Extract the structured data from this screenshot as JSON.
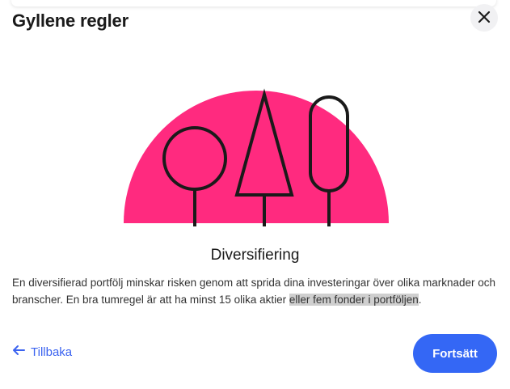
{
  "modal": {
    "title": "Gyllene regler",
    "close_icon": "close-icon"
  },
  "illustration": {
    "description_icon": "trees-illustration",
    "colors": {
      "sun": "#ff2a7f",
      "stroke": "#1a1a1a"
    }
  },
  "content": {
    "heading": "Diversifiering",
    "text_main": "En diversifierad portfölj minskar risken genom att sprida dina investeringar över olika marknader och branscher. En bra tumregel är att ha minst 15 olika aktier ",
    "text_highlighted": "eller fem fonder i portföljen",
    "text_end": "."
  },
  "footer": {
    "back_label": "Tillbaka",
    "back_icon": "arrow-left-icon",
    "continue_label": "Fortsätt"
  },
  "colors": {
    "accent": "#3467f5",
    "link": "#3b63f0"
  }
}
